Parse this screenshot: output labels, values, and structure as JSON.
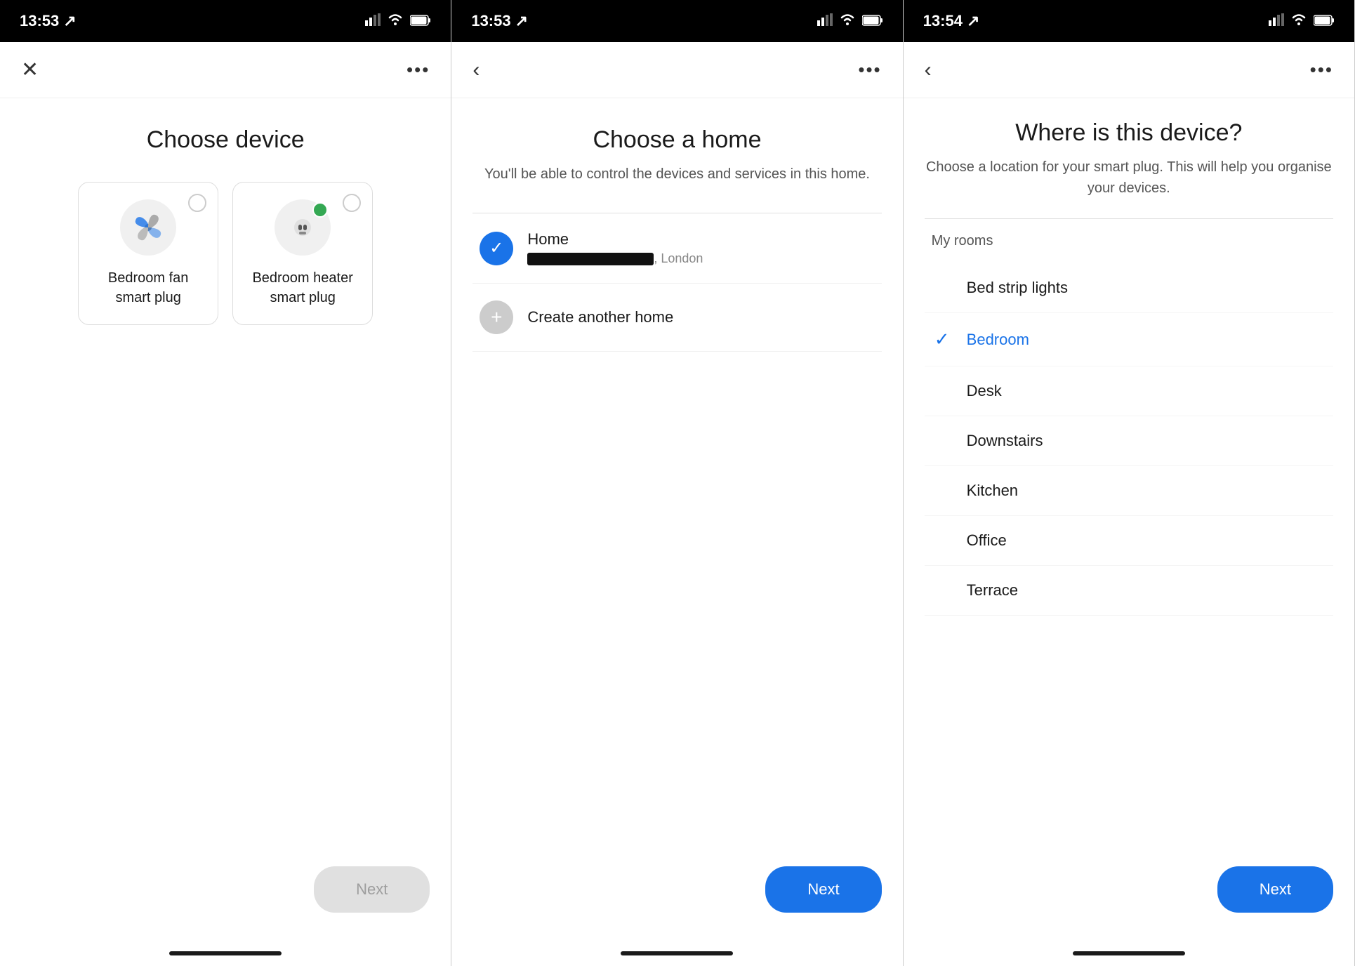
{
  "panels": [
    {
      "id": "choose-device",
      "status_bar": {
        "time": "13:53",
        "location_icon": "◂",
        "signal": "▂▄▆",
        "wifi": "wifi",
        "battery": "🔋"
      },
      "nav": {
        "left": "✕",
        "right": "•••"
      },
      "title": "Choose device",
      "devices": [
        {
          "name_line1": "Bedroom fan",
          "name_line2": "smart plug",
          "selected": false,
          "has_dot": false,
          "icon_type": "fan"
        },
        {
          "name_line1": "Bedroom heater",
          "name_line2": "smart plug",
          "selected": true,
          "has_dot": true,
          "icon_type": "plug"
        }
      ],
      "next_button": "Next",
      "next_disabled": true
    },
    {
      "id": "choose-home",
      "status_bar": {
        "time": "13:53"
      },
      "nav": {
        "left": "‹",
        "right": "•••"
      },
      "title": "Choose a home",
      "subtitle": "You'll be able to control the devices and services in this home.",
      "homes": [
        {
          "type": "existing",
          "name": "Home",
          "address_redacted": true,
          "city": "London",
          "selected": true
        },
        {
          "type": "create",
          "name": "Create another home",
          "selected": false
        }
      ],
      "next_button": "Next",
      "next_disabled": false
    },
    {
      "id": "where-device",
      "status_bar": {
        "time": "13:54"
      },
      "nav": {
        "left": "‹",
        "right": "•••"
      },
      "title": "Where is this device?",
      "subtitle": "Choose a location for your smart plug. This will help you organise your devices.",
      "section_label": "My rooms",
      "rooms": [
        {
          "name": "Bed strip lights",
          "selected": false
        },
        {
          "name": "Bedroom",
          "selected": true
        },
        {
          "name": "Desk",
          "selected": false
        },
        {
          "name": "Downstairs",
          "selected": false
        },
        {
          "name": "Kitchen",
          "selected": false
        },
        {
          "name": "Office",
          "selected": false
        },
        {
          "name": "Terrace",
          "selected": false
        }
      ],
      "next_button": "Next",
      "next_disabled": false
    }
  ]
}
